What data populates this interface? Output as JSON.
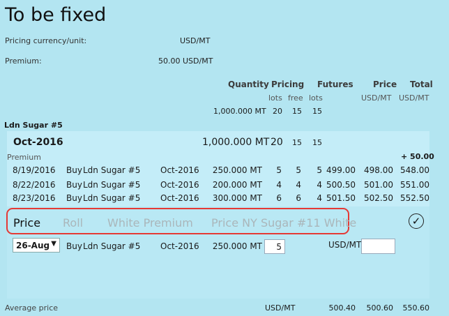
{
  "title": "To be fixed",
  "info": {
    "pricing_currency_label": "Pricing currency/unit:",
    "pricing_currency_value": "USD/MT",
    "premium_label": "Premium:",
    "premium_value": "50.00 USD/MT"
  },
  "columns": {
    "quantity": "Quantity",
    "pricing": "Pricing",
    "futures": "Futures",
    "price": "Price",
    "total": "Total",
    "lots": "lots",
    "free": "free",
    "futures_lots": "lots",
    "price_unit": "USD/MT",
    "total_unit": "USD/MT"
  },
  "summary": {
    "quantity": "1,000.000 MT",
    "pricing_lots": "20",
    "free": "15",
    "futures_lots": "15"
  },
  "commodity": "Ldn Sugar #5",
  "group": {
    "month": "Oct-2016",
    "quantity": "1,000.000 MT",
    "lots": "20",
    "free": "15",
    "futures_lots": "15",
    "premium_label": "Premium",
    "premium_value": "+ 50.00"
  },
  "rows": [
    {
      "date": "8/19/2016",
      "side": "Buy",
      "commodity": "Ldn Sugar #5",
      "month": "Oct-2016",
      "quantity": "250.000 MT",
      "lots": "5",
      "free": "5",
      "flots": "5",
      "futures": "499.00",
      "price": "498.00",
      "total": "548.00"
    },
    {
      "date": "8/22/2016",
      "side": "Buy",
      "commodity": "Ldn Sugar #5",
      "month": "Oct-2016",
      "quantity": "200.000 MT",
      "lots": "4",
      "free": "4",
      "flots": "4",
      "futures": "500.50",
      "price": "501.00",
      "total": "551.00"
    },
    {
      "date": "8/23/2016",
      "side": "Buy",
      "commodity": "Ldn Sugar #5",
      "month": "Oct-2016",
      "quantity": "300.000 MT",
      "lots": "6",
      "free": "6",
      "flots": "4",
      "futures": "501.50",
      "price": "502.50",
      "total": "552.50"
    }
  ],
  "tabs": [
    "Price",
    "Roll",
    "White Premium",
    "Price NY Sugar #11 White"
  ],
  "confirm_icon": "check-circle-icon",
  "entry": {
    "date": "26-Aug",
    "side": "Buy",
    "commodity": "Ldn Sugar #5",
    "month": "Oct-2016",
    "quantity": "250.000 MT",
    "lots": "5",
    "unit": "USD/MT",
    "price": ""
  },
  "footer": {
    "label": "Average price",
    "unit": "USD/MT",
    "futures": "500.40",
    "price": "500.60",
    "total": "550.60"
  },
  "colors": {
    "background": "#b3e5f1",
    "panel": "#c4edf8",
    "tab_highlight": "#e53935"
  }
}
